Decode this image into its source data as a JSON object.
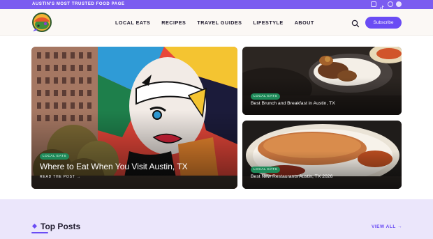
{
  "topbar": {
    "tagline": "AUSTIN'S MOST TRUSTED FOOD PAGE",
    "social_icons": [
      "instagram-icon",
      "tiktok-icon",
      "pinterest-icon",
      "facebook-icon"
    ]
  },
  "header": {
    "nav": [
      "LOCAL EATS",
      "RECIPES",
      "TRAVEL GUIDES",
      "LIFESTYLE",
      "ABOUT"
    ],
    "subscribe_label": "Subscribe"
  },
  "featured": {
    "main": {
      "category": "LOCAL EATS",
      "title": "Where to Eat When You Visit Austin, TX",
      "read_more": "READ THE POST →"
    },
    "top": {
      "category": "LOCAL EATS",
      "title": "Best Brunch and Breakfast in Austin, TX"
    },
    "bottom": {
      "category": "LOCAL EATS",
      "title": "Best New Restaurants Austin, TX 2026"
    }
  },
  "top_posts": {
    "heading": "Top Posts",
    "view_all": "VIEW ALL →"
  },
  "colors": {
    "accent": "#6a4cf4",
    "topbar": "#7b5cf0",
    "badge": "#1f8a5a",
    "section_bg": "#ebe6fb"
  }
}
